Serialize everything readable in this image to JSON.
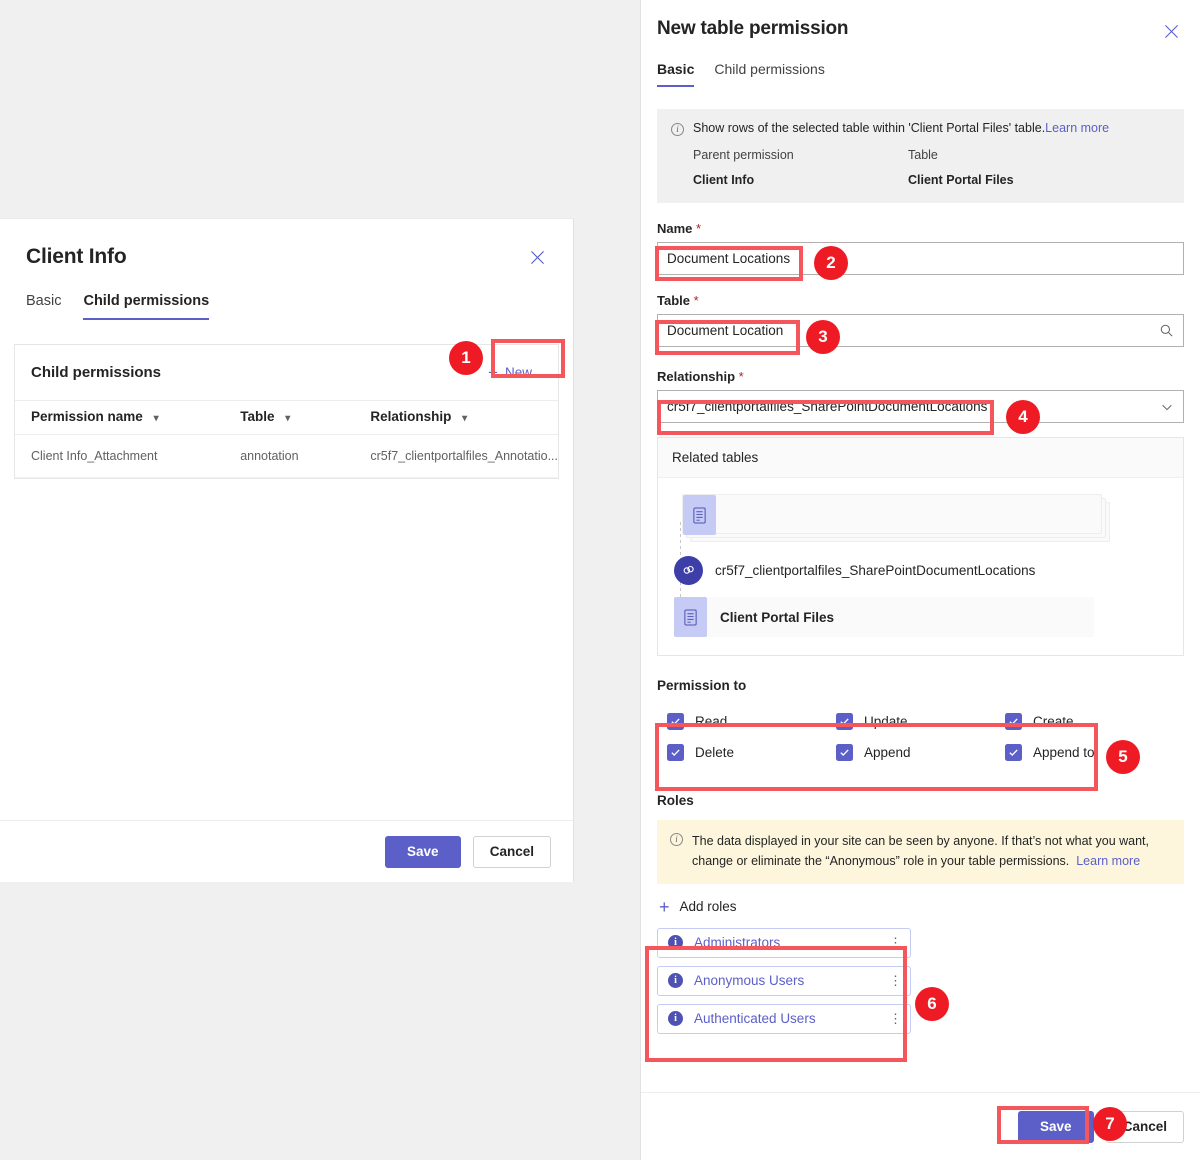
{
  "left_dialog": {
    "title": "Client Info",
    "close_icon": "close-icon",
    "tabs": [
      {
        "label": "Basic",
        "active": false
      },
      {
        "label": "Child permissions",
        "active": true
      }
    ],
    "grid": {
      "title": "Child permissions",
      "new_button": "New",
      "columns": [
        "Permission name",
        "Table",
        "Relationship"
      ],
      "rows": [
        {
          "permission_name": "Client Info_Attachment",
          "table": "annotation",
          "relationship": "cr5f7_clientportalfiles_Annotatio..."
        }
      ]
    },
    "footer": {
      "save": "Save",
      "cancel": "Cancel"
    }
  },
  "right_panel": {
    "title": "New table permission",
    "close_icon": "close-icon",
    "tabs": [
      {
        "label": "Basic",
        "active": true
      },
      {
        "label": "Child permissions",
        "active": false
      }
    ],
    "info_bar": {
      "message": "Show rows of the selected table within 'Client Portal Files' table.",
      "learn_more": "Learn more",
      "parent_permission_label": "Parent permission",
      "parent_permission_value": "Client Info",
      "table_label": "Table",
      "table_value": "Client Portal Files"
    },
    "fields": {
      "name_label": "Name",
      "name_value": "Document Locations",
      "table_label": "Table",
      "table_value": "Document Location",
      "relationship_label": "Relationship",
      "relationship_value": "cr5f7_clientportalfiles_SharePointDocumentLocations",
      "required_marker": "*"
    },
    "related_tables": {
      "header": "Related tables",
      "relationship_node": "cr5f7_clientportalfiles_SharePointDocumentLocations",
      "child_table": "Client Portal Files"
    },
    "permission_to": {
      "label": "Permission to",
      "items": [
        {
          "label": "Read",
          "checked": true
        },
        {
          "label": "Update",
          "checked": true
        },
        {
          "label": "Create",
          "checked": true
        },
        {
          "label": "Delete",
          "checked": true
        },
        {
          "label": "Append",
          "checked": true
        },
        {
          "label": "Append to",
          "checked": true
        }
      ]
    },
    "roles": {
      "label": "Roles",
      "warning": "The data displayed in your site can be seen by anyone. If that’s not what you want, change or eliminate the “Anonymous” role in your table permissions.",
      "warning_link": "Learn more",
      "add_roles": "Add roles",
      "items": [
        {
          "name": "Administrators"
        },
        {
          "name": "Anonymous Users"
        },
        {
          "name": "Authenticated Users"
        }
      ]
    },
    "footer": {
      "save": "Save",
      "cancel": "Cancel"
    }
  },
  "annotations": {
    "badges": [
      {
        "number": "1"
      },
      {
        "number": "2"
      },
      {
        "number": "3"
      },
      {
        "number": "4"
      },
      {
        "number": "5"
      },
      {
        "number": "6"
      },
      {
        "number": "7"
      }
    ],
    "highlight_color": "#f5565c",
    "badge_color": "#ee1b24"
  },
  "colors": {
    "accent_purple": "#5b5fc7",
    "accent_purple_dark": "#4f52b2",
    "page_background": "#f0f0f0",
    "panel_background": "#ffffff",
    "warning_background": "#fdf6dd",
    "info_background": "#f0f0f0"
  }
}
